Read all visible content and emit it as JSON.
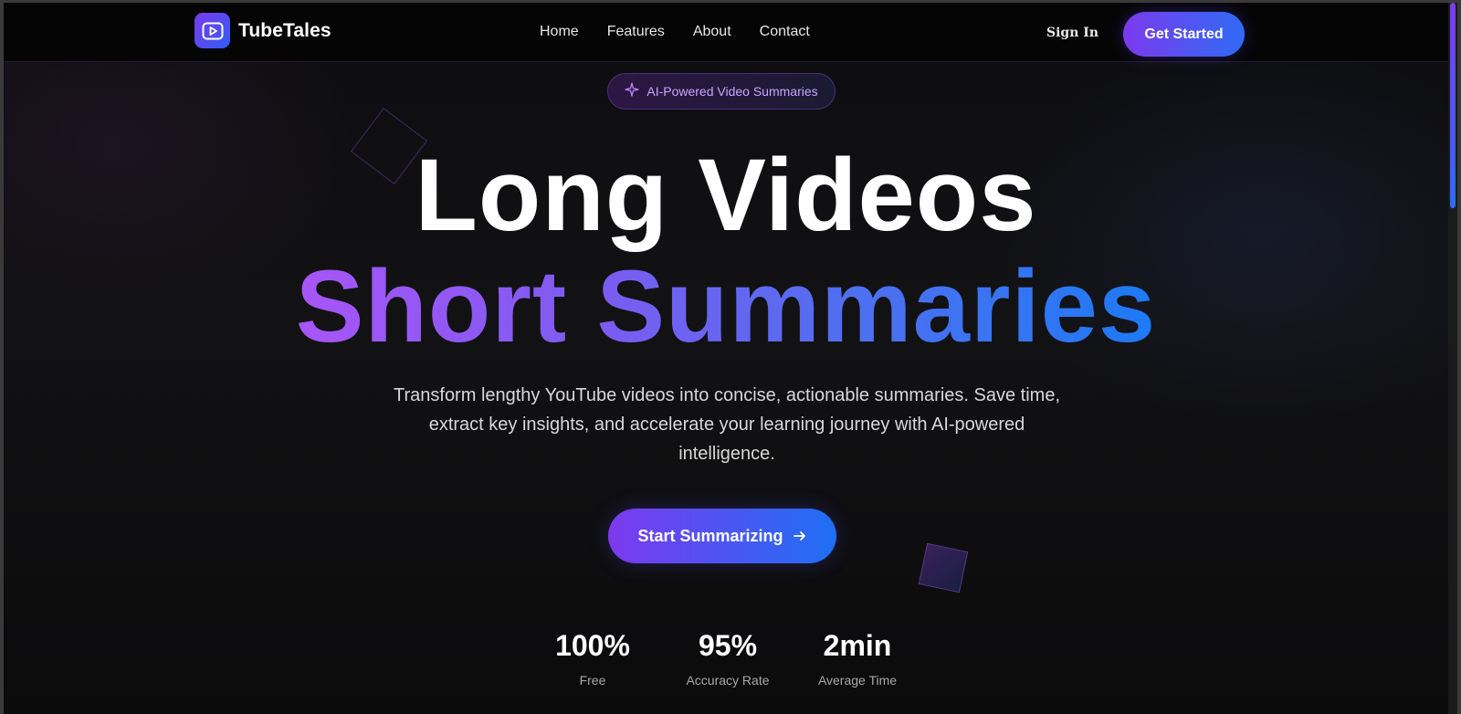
{
  "brand": {
    "name": "TubeTales",
    "logo_icon": "play-icon"
  },
  "nav": {
    "links": [
      "Home",
      "Features",
      "About",
      "Contact"
    ],
    "signin_label": "Sign In",
    "get_started_label": "Get Started"
  },
  "hero": {
    "badge_icon": "sparkle-icon",
    "badge_text": "AI-Powered Video Summaries",
    "headline_line1": "Long Videos",
    "headline_line2": "Short Summaries",
    "subtitle": "Transform lengthy YouTube videos into concise, actionable summaries. Save time, extract key insights, and accelerate your learning journey with AI-powered intelligence.",
    "cta_label": "Start Summarizing",
    "cta_icon": "arrow-right-icon"
  },
  "stats": [
    {
      "value": "100%",
      "label": "Free"
    },
    {
      "value": "95%",
      "label": "Accuracy Rate"
    },
    {
      "value": "2min",
      "label": "Average Time"
    }
  ],
  "colors": {
    "accent_purple": "#7c3aed",
    "accent_blue": "#1f6ff5",
    "gradient_text_start": "#a855f7",
    "gradient_text_end": "#1d7af5",
    "background": "#0d0d0f"
  }
}
